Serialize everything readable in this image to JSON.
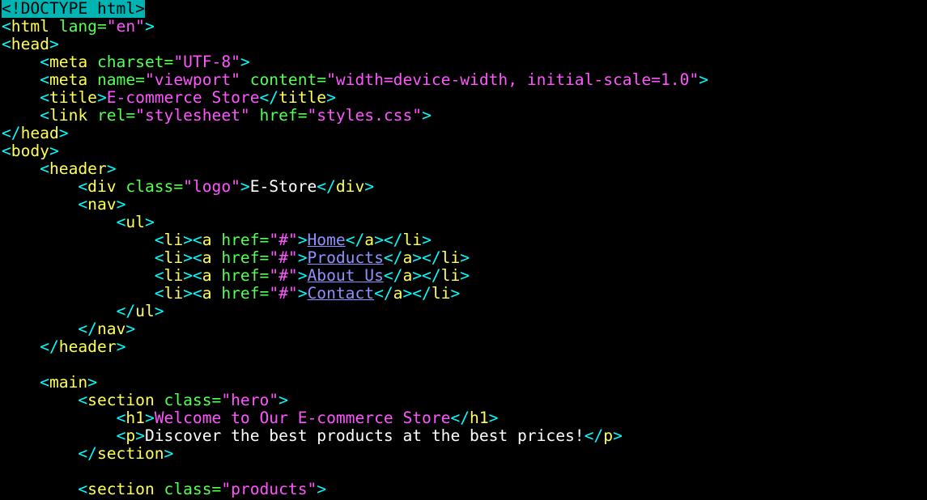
{
  "editor": {
    "colors": {
      "background": "#000000",
      "tag_bracket": "#00ffff",
      "tag_name": "#ffff55",
      "attribute": "#55ff55",
      "value": "#ff55ff",
      "text": "#ffffff",
      "link": "#9090ff",
      "cursor": "#00b4b4"
    },
    "lines": [
      [
        {
          "t": "<",
          "c": "cursor"
        },
        {
          "t": "!DOCTYPE html",
          "c": "cursor-text"
        },
        {
          "t": ">",
          "c": "cursor"
        }
      ],
      [
        {
          "t": "<",
          "c": "tag"
        },
        {
          "t": "html",
          "c": "name"
        },
        {
          "t": " lang=",
          "c": "attr"
        },
        {
          "t": "\"en\"",
          "c": "val"
        },
        {
          "t": ">",
          "c": "tag"
        }
      ],
      [
        {
          "t": "<",
          "c": "tag"
        },
        {
          "t": "head",
          "c": "name"
        },
        {
          "t": ">",
          "c": "tag"
        }
      ],
      [
        {
          "t": "    ",
          "c": "text"
        },
        {
          "t": "<",
          "c": "tag"
        },
        {
          "t": "meta",
          "c": "name"
        },
        {
          "t": " charset=",
          "c": "attr"
        },
        {
          "t": "\"UTF-8\"",
          "c": "val"
        },
        {
          "t": ">",
          "c": "tag"
        }
      ],
      [
        {
          "t": "    ",
          "c": "text"
        },
        {
          "t": "<",
          "c": "tag"
        },
        {
          "t": "meta",
          "c": "name"
        },
        {
          "t": " name=",
          "c": "attr"
        },
        {
          "t": "\"viewport\"",
          "c": "val"
        },
        {
          "t": " content=",
          "c": "attr"
        },
        {
          "t": "\"width=device-width, initial-scale=1.0\"",
          "c": "val"
        },
        {
          "t": ">",
          "c": "tag"
        }
      ],
      [
        {
          "t": "    ",
          "c": "text"
        },
        {
          "t": "<",
          "c": "tag"
        },
        {
          "t": "title",
          "c": "name"
        },
        {
          "t": ">",
          "c": "tag"
        },
        {
          "t": "E-commerce Store",
          "c": "title"
        },
        {
          "t": "</",
          "c": "tag"
        },
        {
          "t": "title",
          "c": "name"
        },
        {
          "t": ">",
          "c": "tag"
        }
      ],
      [
        {
          "t": "    ",
          "c": "text"
        },
        {
          "t": "<",
          "c": "tag"
        },
        {
          "t": "link",
          "c": "name"
        },
        {
          "t": " rel=",
          "c": "attr"
        },
        {
          "t": "\"stylesheet\"",
          "c": "val"
        },
        {
          "t": " href=",
          "c": "attr"
        },
        {
          "t": "\"styles.css\"",
          "c": "val"
        },
        {
          "t": ">",
          "c": "tag"
        }
      ],
      [
        {
          "t": "</",
          "c": "tag"
        },
        {
          "t": "head",
          "c": "name"
        },
        {
          "t": ">",
          "c": "tag"
        }
      ],
      [
        {
          "t": "<",
          "c": "tag"
        },
        {
          "t": "body",
          "c": "name"
        },
        {
          "t": ">",
          "c": "tag"
        }
      ],
      [
        {
          "t": "    ",
          "c": "text"
        },
        {
          "t": "<",
          "c": "tag"
        },
        {
          "t": "header",
          "c": "name"
        },
        {
          "t": ">",
          "c": "tag"
        }
      ],
      [
        {
          "t": "        ",
          "c": "text"
        },
        {
          "t": "<",
          "c": "tag"
        },
        {
          "t": "div",
          "c": "name"
        },
        {
          "t": " class=",
          "c": "attr"
        },
        {
          "t": "\"logo\"",
          "c": "val"
        },
        {
          "t": ">",
          "c": "tag"
        },
        {
          "t": "E-Store",
          "c": "text"
        },
        {
          "t": "</",
          "c": "tag"
        },
        {
          "t": "div",
          "c": "name"
        },
        {
          "t": ">",
          "c": "tag"
        }
      ],
      [
        {
          "t": "        ",
          "c": "text"
        },
        {
          "t": "<",
          "c": "tag"
        },
        {
          "t": "nav",
          "c": "name"
        },
        {
          "t": ">",
          "c": "tag"
        }
      ],
      [
        {
          "t": "            ",
          "c": "text"
        },
        {
          "t": "<",
          "c": "tag"
        },
        {
          "t": "ul",
          "c": "name"
        },
        {
          "t": ">",
          "c": "tag"
        }
      ],
      [
        {
          "t": "                ",
          "c": "text"
        },
        {
          "t": "<",
          "c": "tag"
        },
        {
          "t": "li",
          "c": "name"
        },
        {
          "t": "><",
          "c": "tag"
        },
        {
          "t": "a",
          "c": "name"
        },
        {
          "t": " href=",
          "c": "attr"
        },
        {
          "t": "\"#\"",
          "c": "val"
        },
        {
          "t": ">",
          "c": "tag"
        },
        {
          "t": "Home",
          "c": "link"
        },
        {
          "t": "</",
          "c": "tag"
        },
        {
          "t": "a",
          "c": "name"
        },
        {
          "t": "></",
          "c": "tag"
        },
        {
          "t": "li",
          "c": "name"
        },
        {
          "t": ">",
          "c": "tag"
        }
      ],
      [
        {
          "t": "                ",
          "c": "text"
        },
        {
          "t": "<",
          "c": "tag"
        },
        {
          "t": "li",
          "c": "name"
        },
        {
          "t": "><",
          "c": "tag"
        },
        {
          "t": "a",
          "c": "name"
        },
        {
          "t": " href=",
          "c": "attr"
        },
        {
          "t": "\"#\"",
          "c": "val"
        },
        {
          "t": ">",
          "c": "tag"
        },
        {
          "t": "Products",
          "c": "link"
        },
        {
          "t": "</",
          "c": "tag"
        },
        {
          "t": "a",
          "c": "name"
        },
        {
          "t": "></",
          "c": "tag"
        },
        {
          "t": "li",
          "c": "name"
        },
        {
          "t": ">",
          "c": "tag"
        }
      ],
      [
        {
          "t": "                ",
          "c": "text"
        },
        {
          "t": "<",
          "c": "tag"
        },
        {
          "t": "li",
          "c": "name"
        },
        {
          "t": "><",
          "c": "tag"
        },
        {
          "t": "a",
          "c": "name"
        },
        {
          "t": " href=",
          "c": "attr"
        },
        {
          "t": "\"#\"",
          "c": "val"
        },
        {
          "t": ">",
          "c": "tag"
        },
        {
          "t": "About Us",
          "c": "link"
        },
        {
          "t": "</",
          "c": "tag"
        },
        {
          "t": "a",
          "c": "name"
        },
        {
          "t": "></",
          "c": "tag"
        },
        {
          "t": "li",
          "c": "name"
        },
        {
          "t": ">",
          "c": "tag"
        }
      ],
      [
        {
          "t": "                ",
          "c": "text"
        },
        {
          "t": "<",
          "c": "tag"
        },
        {
          "t": "li",
          "c": "name"
        },
        {
          "t": "><",
          "c": "tag"
        },
        {
          "t": "a",
          "c": "name"
        },
        {
          "t": " href=",
          "c": "attr"
        },
        {
          "t": "\"#\"",
          "c": "val"
        },
        {
          "t": ">",
          "c": "tag"
        },
        {
          "t": "Contact",
          "c": "link"
        },
        {
          "t": "</",
          "c": "tag"
        },
        {
          "t": "a",
          "c": "name"
        },
        {
          "t": "></",
          "c": "tag"
        },
        {
          "t": "li",
          "c": "name"
        },
        {
          "t": ">",
          "c": "tag"
        }
      ],
      [
        {
          "t": "            ",
          "c": "text"
        },
        {
          "t": "</",
          "c": "tag"
        },
        {
          "t": "ul",
          "c": "name"
        },
        {
          "t": ">",
          "c": "tag"
        }
      ],
      [
        {
          "t": "        ",
          "c": "text"
        },
        {
          "t": "</",
          "c": "tag"
        },
        {
          "t": "nav",
          "c": "name"
        },
        {
          "t": ">",
          "c": "tag"
        }
      ],
      [
        {
          "t": "    ",
          "c": "text"
        },
        {
          "t": "</",
          "c": "tag"
        },
        {
          "t": "header",
          "c": "name"
        },
        {
          "t": ">",
          "c": "tag"
        }
      ],
      [],
      [
        {
          "t": "    ",
          "c": "text"
        },
        {
          "t": "<",
          "c": "tag"
        },
        {
          "t": "main",
          "c": "name"
        },
        {
          "t": ">",
          "c": "tag"
        }
      ],
      [
        {
          "t": "        ",
          "c": "text"
        },
        {
          "t": "<",
          "c": "tag"
        },
        {
          "t": "section",
          "c": "name"
        },
        {
          "t": " class=",
          "c": "attr"
        },
        {
          "t": "\"hero\"",
          "c": "val"
        },
        {
          "t": ">",
          "c": "tag"
        }
      ],
      [
        {
          "t": "            ",
          "c": "text"
        },
        {
          "t": "<",
          "c": "tag"
        },
        {
          "t": "h1",
          "c": "name"
        },
        {
          "t": ">",
          "c": "tag"
        },
        {
          "t": "Welcome to Our E-commerce Store",
          "c": "h1"
        },
        {
          "t": "</",
          "c": "tag"
        },
        {
          "t": "h1",
          "c": "name"
        },
        {
          "t": ">",
          "c": "tag"
        }
      ],
      [
        {
          "t": "            ",
          "c": "text"
        },
        {
          "t": "<",
          "c": "tag"
        },
        {
          "t": "p",
          "c": "name"
        },
        {
          "t": ">",
          "c": "tag"
        },
        {
          "t": "Discover the best products at the best prices!",
          "c": "text"
        },
        {
          "t": "</",
          "c": "tag"
        },
        {
          "t": "p",
          "c": "name"
        },
        {
          "t": ">",
          "c": "tag"
        }
      ],
      [
        {
          "t": "        ",
          "c": "text"
        },
        {
          "t": "</",
          "c": "tag"
        },
        {
          "t": "section",
          "c": "name"
        },
        {
          "t": ">",
          "c": "tag"
        }
      ],
      [],
      [
        {
          "t": "        ",
          "c": "text"
        },
        {
          "t": "<",
          "c": "tag"
        },
        {
          "t": "section",
          "c": "name"
        },
        {
          "t": " class=",
          "c": "attr"
        },
        {
          "t": "\"products\"",
          "c": "val"
        },
        {
          "t": ">",
          "c": "tag"
        }
      ]
    ]
  }
}
